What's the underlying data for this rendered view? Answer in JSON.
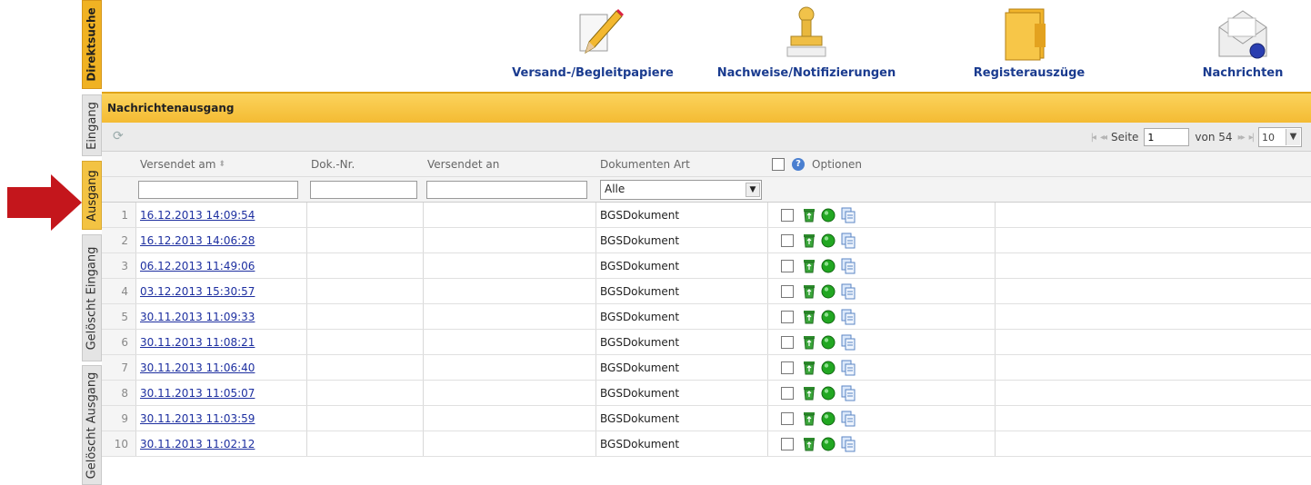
{
  "side_tabs": {
    "direktsuche": "Direktsuche",
    "eingang": "Eingang",
    "ausgang": "Ausgang",
    "geloescht_eingang": "Gelöscht Eingang",
    "geloescht_ausgang": "Gelöscht Ausgang"
  },
  "topnav": {
    "versand": "Versand-/Begleitpapiere",
    "nachweise": "Nachweise/Notifizierungen",
    "register": "Registerauszüge",
    "nachrichten": "Nachrichten"
  },
  "panel": {
    "title": "Nachrichtenausgang"
  },
  "pager": {
    "page_label": "Seite",
    "page_value": "1",
    "of_label": "von 54",
    "page_size": "10"
  },
  "columns": {
    "versendet_am": "Versendet am",
    "dok_nr": "Dok.-Nr.",
    "versendet_an": "Versendet an",
    "dokumenten_art": "Dokumenten Art",
    "optionen": "Optionen"
  },
  "filter": {
    "art_selected": "Alle"
  },
  "rows": [
    {
      "num": "1",
      "date": "16.12.2013 14:09:54",
      "art": "BGSDokument"
    },
    {
      "num": "2",
      "date": "16.12.2013 14:06:28",
      "art": "BGSDokument"
    },
    {
      "num": "3",
      "date": "06.12.2013 11:49:06",
      "art": "BGSDokument"
    },
    {
      "num": "4",
      "date": "03.12.2013 15:30:57",
      "art": "BGSDokument"
    },
    {
      "num": "5",
      "date": "30.11.2013 11:09:33",
      "art": "BGSDokument"
    },
    {
      "num": "6",
      "date": "30.11.2013 11:08:21",
      "art": "BGSDokument"
    },
    {
      "num": "7",
      "date": "30.11.2013 11:06:40",
      "art": "BGSDokument"
    },
    {
      "num": "8",
      "date": "30.11.2013 11:05:07",
      "art": "BGSDokument"
    },
    {
      "num": "9",
      "date": "30.11.2013 11:03:59",
      "art": "BGSDokument"
    },
    {
      "num": "10",
      "date": "30.11.2013 11:02:12",
      "art": "BGSDokument"
    }
  ],
  "icons": {
    "refresh": "refresh-icon",
    "recycle": "recycle-icon",
    "status": "green-status-icon",
    "copy": "copy-document-icon"
  },
  "colors": {
    "accent": "#f4bb33",
    "link": "#1d2fa0",
    "arrow": "#c4161c"
  }
}
